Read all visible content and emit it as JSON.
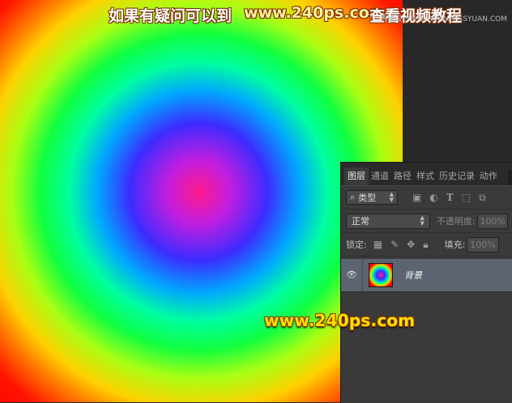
{
  "overlay": {
    "caption_part1": "如果有疑问可以到",
    "caption_url": "www.240ps.com",
    "caption_part2": "查看视频教程",
    "corner_watermark": "思缘设计论坛 WWW.MISSYUAN.COM",
    "bottom_watermark": "www.240ps.com"
  },
  "canvas": {
    "gradient_colors": [
      "#ff1a8c",
      "#3c2cff",
      "#00a8ff",
      "#00ff80",
      "#a8ff14",
      "#ff7a00",
      "#ff0000"
    ]
  },
  "layers_panel": {
    "tabs": [
      {
        "label": "图层",
        "active": true
      },
      {
        "label": "通道"
      },
      {
        "label": "路径"
      },
      {
        "label": "样式"
      },
      {
        "label": "历史记录"
      },
      {
        "label": "动作"
      }
    ],
    "filter": {
      "label": "类型",
      "icons": [
        "image-filter-icon",
        "adjustment-filter-icon",
        "type-filter-icon",
        "shape-filter-icon",
        "smart-object-filter-icon"
      ]
    },
    "blend_mode": "正常",
    "opacity_label": "不透明度:",
    "opacity_value": "100%",
    "lock_label": "锁定:",
    "fill_label": "填充:",
    "fill_value": "100%",
    "layers": [
      {
        "name": "背景",
        "visible": true,
        "selected": true
      }
    ]
  }
}
